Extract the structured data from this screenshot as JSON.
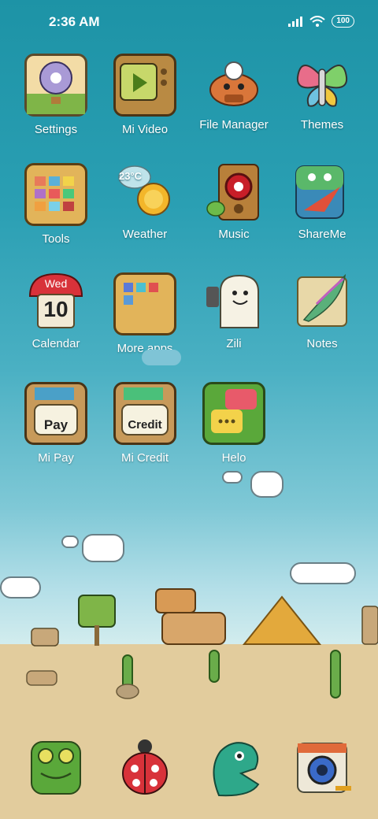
{
  "status_bar": {
    "time": "2:36 AM",
    "battery": "100"
  },
  "apps": [
    {
      "label": "Settings"
    },
    {
      "label": "Mi Video"
    },
    {
      "label": "File Manager"
    },
    {
      "label": "Themes"
    },
    {
      "label": "Tools"
    },
    {
      "label": "Weather",
      "temperature": "23°C"
    },
    {
      "label": "Music"
    },
    {
      "label": "ShareMe"
    },
    {
      "label": "Calendar",
      "day": "Wed",
      "date": "10"
    },
    {
      "label": "More apps"
    },
    {
      "label": "Zili"
    },
    {
      "label": "Notes"
    },
    {
      "label": "Mi Pay",
      "card_text": "Pay"
    },
    {
      "label": "Mi Credit",
      "card_text": "Credit"
    },
    {
      "label": "Helo"
    }
  ],
  "dock": [
    {
      "icon": "frog-icon"
    },
    {
      "icon": "ladybug-icon"
    },
    {
      "icon": "green-creature-icon"
    },
    {
      "icon": "camera-icon"
    }
  ]
}
